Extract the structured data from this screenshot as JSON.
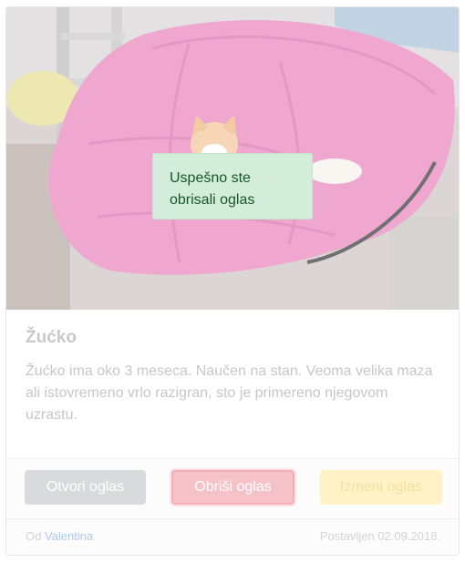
{
  "listing": {
    "title": "Žućko",
    "description": "Žućko ima oko 3 meseca. Naučen na stan. Veoma velika maza ali istovremeno vrlo razigran, sto je primereno njegovom uzrastu.",
    "photo_icon": "cat-on-pink-papasan-cushion"
  },
  "actions": {
    "open_label": "Otvori oglas",
    "delete_label": "Obriši oglas",
    "edit_label": "Izmeni oglas"
  },
  "meta": {
    "by_prefix": "Od",
    "author": "Valentina",
    "posted": "Postavljen 02.09.2018."
  },
  "toast": {
    "message": "Uspešno ste obrisali oglas"
  },
  "colors": {
    "success_bg": "#d4edda",
    "success_text": "#155724",
    "danger": "#f5c2c7",
    "warning": "#fff2c6",
    "secondary": "#d9dadb",
    "link": "#a9c9ef"
  }
}
